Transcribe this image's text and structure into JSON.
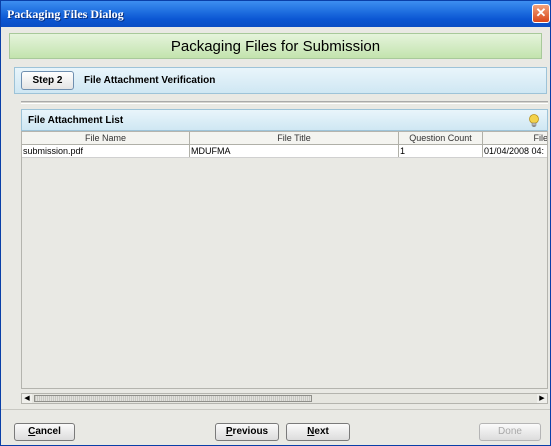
{
  "window": {
    "title": "Packaging Files Dialog",
    "close_glyph": "✕"
  },
  "banner": {
    "title": "Packaging Files for Submission"
  },
  "step": {
    "button_label": "Step 2",
    "description": "File Attachment Verification"
  },
  "list": {
    "title": "File Attachment List",
    "columns": [
      "File Name",
      "File Title",
      "Question Count",
      "File"
    ],
    "rows": [
      [
        "submission.pdf",
        "MDUFMA",
        "1",
        "01/04/2008 04:"
      ]
    ]
  },
  "scroll": {
    "left_arrow": "◀",
    "right_arrow": "▶"
  },
  "buttons": {
    "cancel_first": "C",
    "cancel_rest": "ancel",
    "previous_first": "P",
    "previous_rest": "revious",
    "next_first": "N",
    "next_rest": "ext",
    "done": "Done"
  },
  "colors": {
    "title_bar": "#0b56d3",
    "banner": "#c3e3ad",
    "panel": "#cfe7f3",
    "close": "#d9461a"
  },
  "icons": {
    "close": "close-icon",
    "hint": "lightbulb-icon"
  }
}
